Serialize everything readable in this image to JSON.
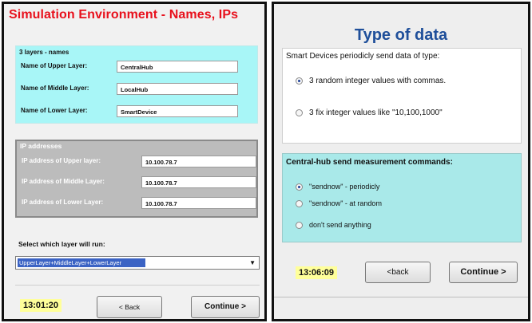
{
  "left": {
    "title": "Simulation Environment - Names, IPs",
    "names_group": {
      "title": "3 layers - names",
      "rows": [
        {
          "label": "Name of Upper Layer:",
          "value": "CentralHub"
        },
        {
          "label": "Name of Middle Layer:",
          "value": "LocalHub"
        },
        {
          "label": "Name of Lower Layer:",
          "value": "SmartDevice"
        }
      ]
    },
    "ip_group": {
      "title": "IP addresses",
      "rows": [
        {
          "label": "IP address of Upper layer:",
          "value": "10.100.78.7"
        },
        {
          "label": "IP address of Middle Layer:",
          "value": "10.100.78.7"
        },
        {
          "label": "IP address of Lower Layer:",
          "value": "10.100.78.7"
        }
      ]
    },
    "select_label": "Select which  layer will run:",
    "select_value": "UpperLayer+MiddleLayer+LowerLayer",
    "time": "13:01:20",
    "back_label": "< Back",
    "continue_label": "Continue >"
  },
  "right": {
    "title": "Type of data",
    "type_panel": {
      "title": "Smart Devices periodicly send data of type:",
      "options": [
        {
          "label": "3 random integer values with commas.",
          "selected": true
        },
        {
          "label": "3 fix integer values like \"10,100,1000\"",
          "selected": false
        }
      ]
    },
    "cmd_panel": {
      "title": "Central-hub send measurement commands:",
      "options": [
        {
          "label": "\"sendnow\"  - periodicly",
          "selected": true
        },
        {
          "label": "\"sendnow\" - at random",
          "selected": false
        },
        {
          "label": "don't send anything",
          "selected": false
        }
      ]
    },
    "time": "13:06:09",
    "back_label": "<back",
    "continue_label": "Continue >"
  },
  "colors": {
    "title_red": "#e8101c",
    "title_blue": "#1f4f9a",
    "names_bg": "#a8f6f7",
    "ip_bg": "#bcbcbc",
    "cmd_bg": "#a9e9e9",
    "time_bg": "#ffff9a",
    "select_highlight": "#3b63c4"
  },
  "icons": {
    "dropdown": "chevron-down-icon",
    "radio": "radio-icon"
  }
}
